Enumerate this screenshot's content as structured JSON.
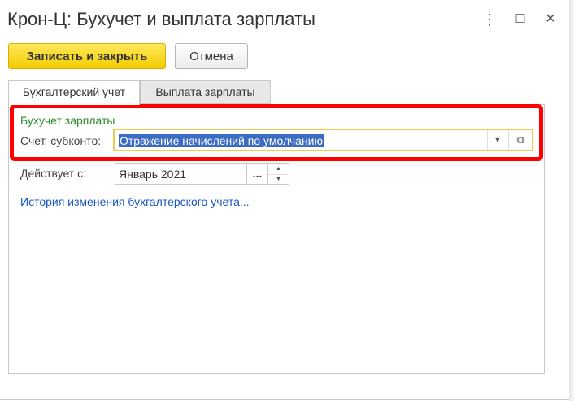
{
  "window": {
    "title": "Крон-Ц: Бухучет и выплата зарплаты",
    "more_icon": "⋮",
    "maximize_icon": "☐",
    "close_icon": "✕"
  },
  "toolbar": {
    "save_close_label": "Записать и закрыть",
    "cancel_label": "Отмена"
  },
  "tabs": [
    {
      "label": "Бухгалтерский учет",
      "active": true
    },
    {
      "label": "Выплата зарплаты",
      "active": false
    }
  ],
  "group": {
    "title": "Бухучет зарплаты",
    "account_label": "Счет, субконто:",
    "account_value": "Отражение начислений по умолчанию",
    "dropdown_icon": "▼",
    "open_icon": "⧉"
  },
  "effective": {
    "label": "Действует с:",
    "value": "Январь 2021",
    "select_label": "...",
    "spin_up": "▲",
    "spin_down": "▼"
  },
  "history_link": "История изменения бухгалтерского учета...",
  "colors": {
    "highlight": "#ff0000",
    "primary_button": "#f2cc00",
    "group_title": "#2e8b2e",
    "link": "#1a56c4",
    "selection": "#3c6bc4"
  }
}
